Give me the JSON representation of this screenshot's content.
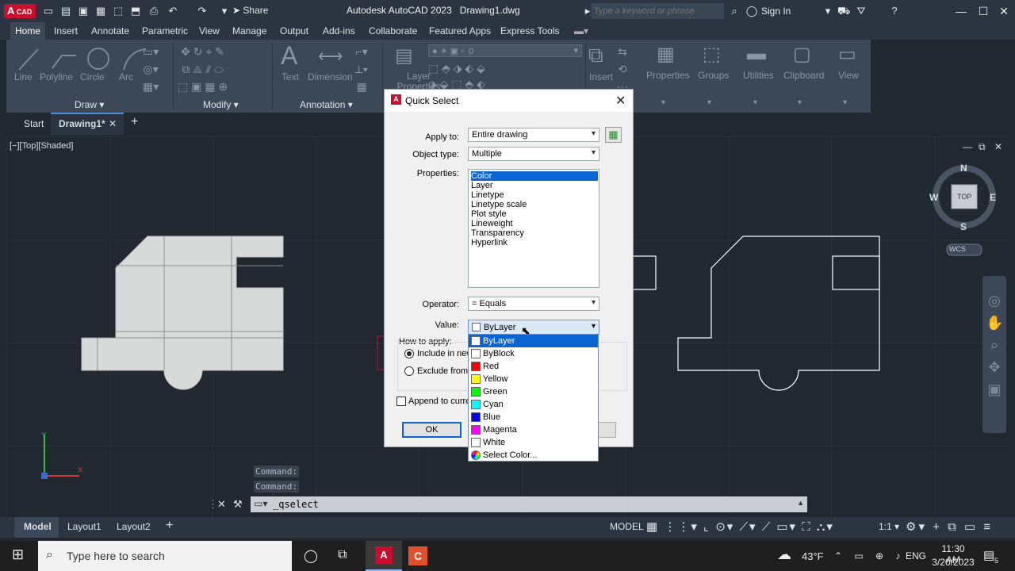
{
  "window": {
    "title": "Autodesk AutoCAD 2023",
    "doc": "Drawing1.dwg",
    "logo_main": "A",
    "logo_sub": "CAD",
    "share": "Share",
    "search_placeholder": "Type a keyword or phrase",
    "sign_in": "Sign In"
  },
  "ribbon_tabs": [
    "Home",
    "Insert",
    "Annotate",
    "Parametric",
    "View",
    "Manage",
    "Output",
    "Add-ins",
    "Collaborate",
    "Featured Apps",
    "Express Tools"
  ],
  "ribbon": {
    "draw_tools": [
      "Line",
      "Polyline",
      "Circle",
      "Arc"
    ],
    "annotation_tools": [
      "Text",
      "Dimension"
    ],
    "layer_props": "Layer Properties",
    "layer_value": "0",
    "insert": "Insert",
    "properties": "Properties",
    "groups": "Groups",
    "utilities": "Utilities",
    "clipboard": "Clipboard",
    "view": "View",
    "panels": {
      "draw": "Draw",
      "modify": "Modify",
      "annotation": "Annotation"
    }
  },
  "doc_tabs": {
    "start": "Start",
    "drawing": "Drawing1*"
  },
  "viewport": {
    "label": "[−][Top][Shaded]",
    "viewcube": {
      "n": "N",
      "s": "S",
      "e": "E",
      "w": "W",
      "top": "TOP",
      "wcs": "WCS"
    }
  },
  "dialog": {
    "title": "Quick Select",
    "apply_to_label": "Apply to:",
    "apply_to_value": "Entire drawing",
    "object_type_label": "Object type:",
    "object_type_value": "Multiple",
    "properties_label": "Properties:",
    "properties": [
      "Color",
      "Layer",
      "Linetype",
      "Linetype scale",
      "Plot style",
      "Lineweight",
      "Transparency",
      "Hyperlink"
    ],
    "operator_label": "Operator:",
    "operator_value": "= Equals",
    "value_label": "Value:",
    "value_value": "ByLayer",
    "how_to_apply": "How to apply:",
    "include": "Include in new",
    "exclude": "Exclude from n",
    "append": "Append to curren",
    "ok": "OK"
  },
  "value_options": [
    {
      "label": "ByLayer",
      "color": "#ffffff"
    },
    {
      "label": "ByBlock",
      "color": "#ffffff"
    },
    {
      "label": "Red",
      "color": "#ff0000"
    },
    {
      "label": "Yellow",
      "color": "#ffff00"
    },
    {
      "label": "Green",
      "color": "#00ff00"
    },
    {
      "label": "Cyan",
      "color": "#00ffff"
    },
    {
      "label": "Blue",
      "color": "#0000ff"
    },
    {
      "label": "Magenta",
      "color": "#ff00ff"
    },
    {
      "label": "White",
      "color": "#ffffff"
    },
    {
      "label": "Select Color...",
      "color": "wheel"
    }
  ],
  "command": {
    "history": [
      "Command:",
      "Command:"
    ],
    "current": "_qselect"
  },
  "status": {
    "model_tab": "Model",
    "layouts": [
      "Layout1",
      "Layout2"
    ],
    "model": "MODEL",
    "scale": "1:1"
  },
  "taskbar": {
    "search": "Type here to search",
    "weather": "43°F",
    "lang": "ENG",
    "time": "11:30 AM",
    "date": "3/20/2023",
    "notif": "5"
  }
}
